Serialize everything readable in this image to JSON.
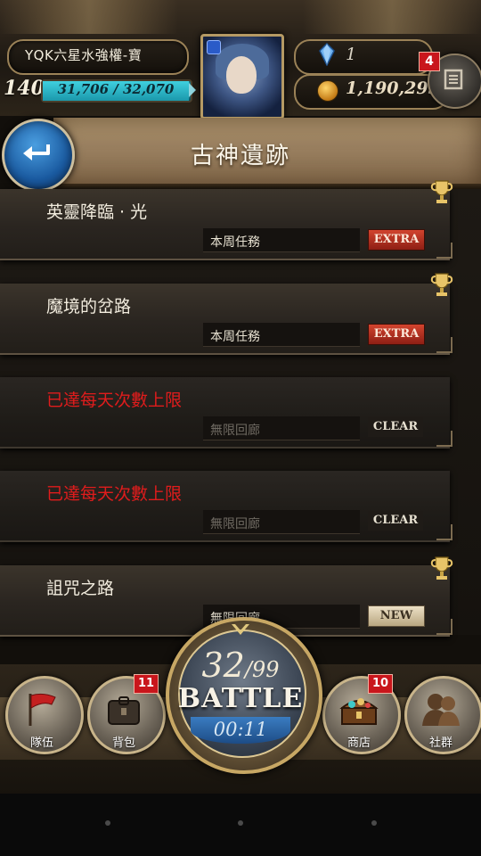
{
  "player": {
    "name": "YQK六星水強權-寶",
    "level": "140",
    "stamina_text": "31,706 / 32,070",
    "stamina_fraction": 0.989
  },
  "currency": {
    "gems": "1",
    "coins": "1,190,295"
  },
  "menu": {
    "badge": "4",
    "icon": "menu-book-icon"
  },
  "header": {
    "title": "古神遺跡",
    "back_icon": "back-arrow-icon"
  },
  "quests": [
    {
      "name": "英靈降臨 · 光",
      "sub": "本周任務",
      "tag": "EXTRA",
      "state": "available",
      "trophy": true
    },
    {
      "name": "魔境的岔路",
      "sub": "本周任務",
      "tag": "EXTRA",
      "state": "available",
      "trophy": true
    },
    {
      "name": "已達每天次數上限",
      "sub": "無限回廊",
      "tag": "CLEAR",
      "state": "limit",
      "trophy": false
    },
    {
      "name": "已達每天次數上限",
      "sub": "無限回廊",
      "tag": "CLEAR",
      "state": "limit",
      "trophy": false
    },
    {
      "name": "詛咒之路",
      "sub": "無限回廊",
      "tag": "NEW",
      "state": "available",
      "trophy": true
    }
  ],
  "battle": {
    "current": "32",
    "max": "/99",
    "label": "BATTLE",
    "timer": "00:11"
  },
  "nav": [
    {
      "label": "隊伍",
      "icon": "flag-icon",
      "badge": ""
    },
    {
      "label": "背包",
      "icon": "backpack-icon",
      "badge": "11"
    },
    {
      "label": "商店",
      "icon": "treasure-chest-icon",
      "badge": "10"
    },
    {
      "label": "社群",
      "icon": "people-icon",
      "badge": ""
    }
  ],
  "colors": {
    "extra_tag": "#c0392b",
    "limit_text": "#e01c1c",
    "stamina": "#28b1c4",
    "badge": "#c9161c"
  }
}
